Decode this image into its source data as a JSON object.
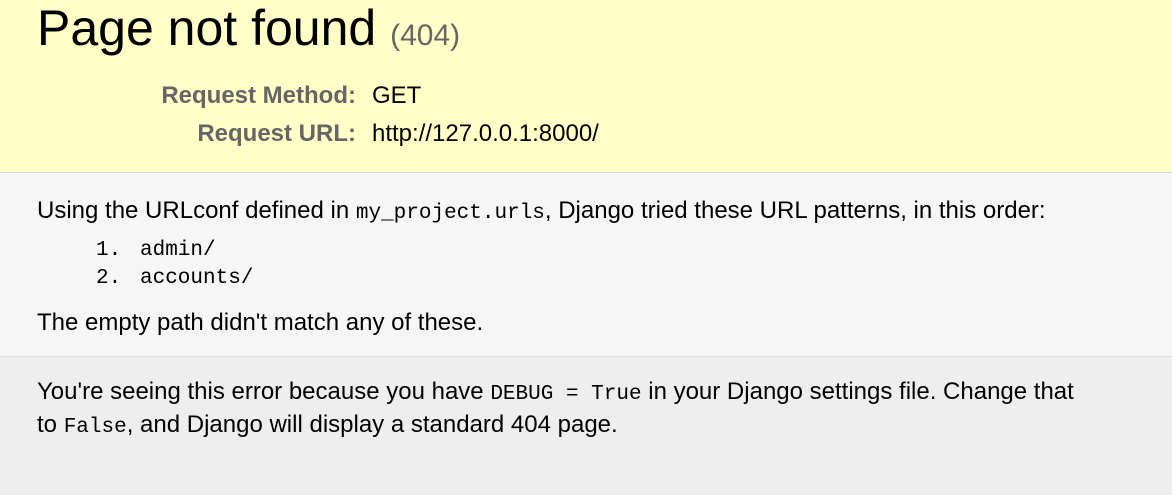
{
  "summary": {
    "title": "Page not found",
    "status_code": "(404)",
    "request_method_label": "Request Method:",
    "request_method_value": "GET",
    "request_url_label": "Request URL:",
    "request_url_value": "http://127.0.0.1:8000/"
  },
  "info": {
    "intro_prefix": "Using the URLconf defined in ",
    "urlconf_module": "my_project.urls",
    "intro_suffix": ", Django tried these URL patterns, in this order:",
    "patterns": [
      {
        "num": "1.",
        "pattern": "admin/"
      },
      {
        "num": "2.",
        "pattern": "accounts/"
      }
    ],
    "outro": "The empty path didn't match any of these."
  },
  "explanation": {
    "part1": "You're seeing this error because you have ",
    "debug_code": "DEBUG = True",
    "part2": " in your Django settings file. Change that",
    "part3": "to ",
    "false_code": "False",
    "part4": ", and Django will display a standard 404 page."
  },
  "colors": {
    "summary_bg": "#ffffc8",
    "info_bg": "#f6f6f6",
    "explanation_bg": "#eeeeee",
    "label_gray": "#666666"
  }
}
